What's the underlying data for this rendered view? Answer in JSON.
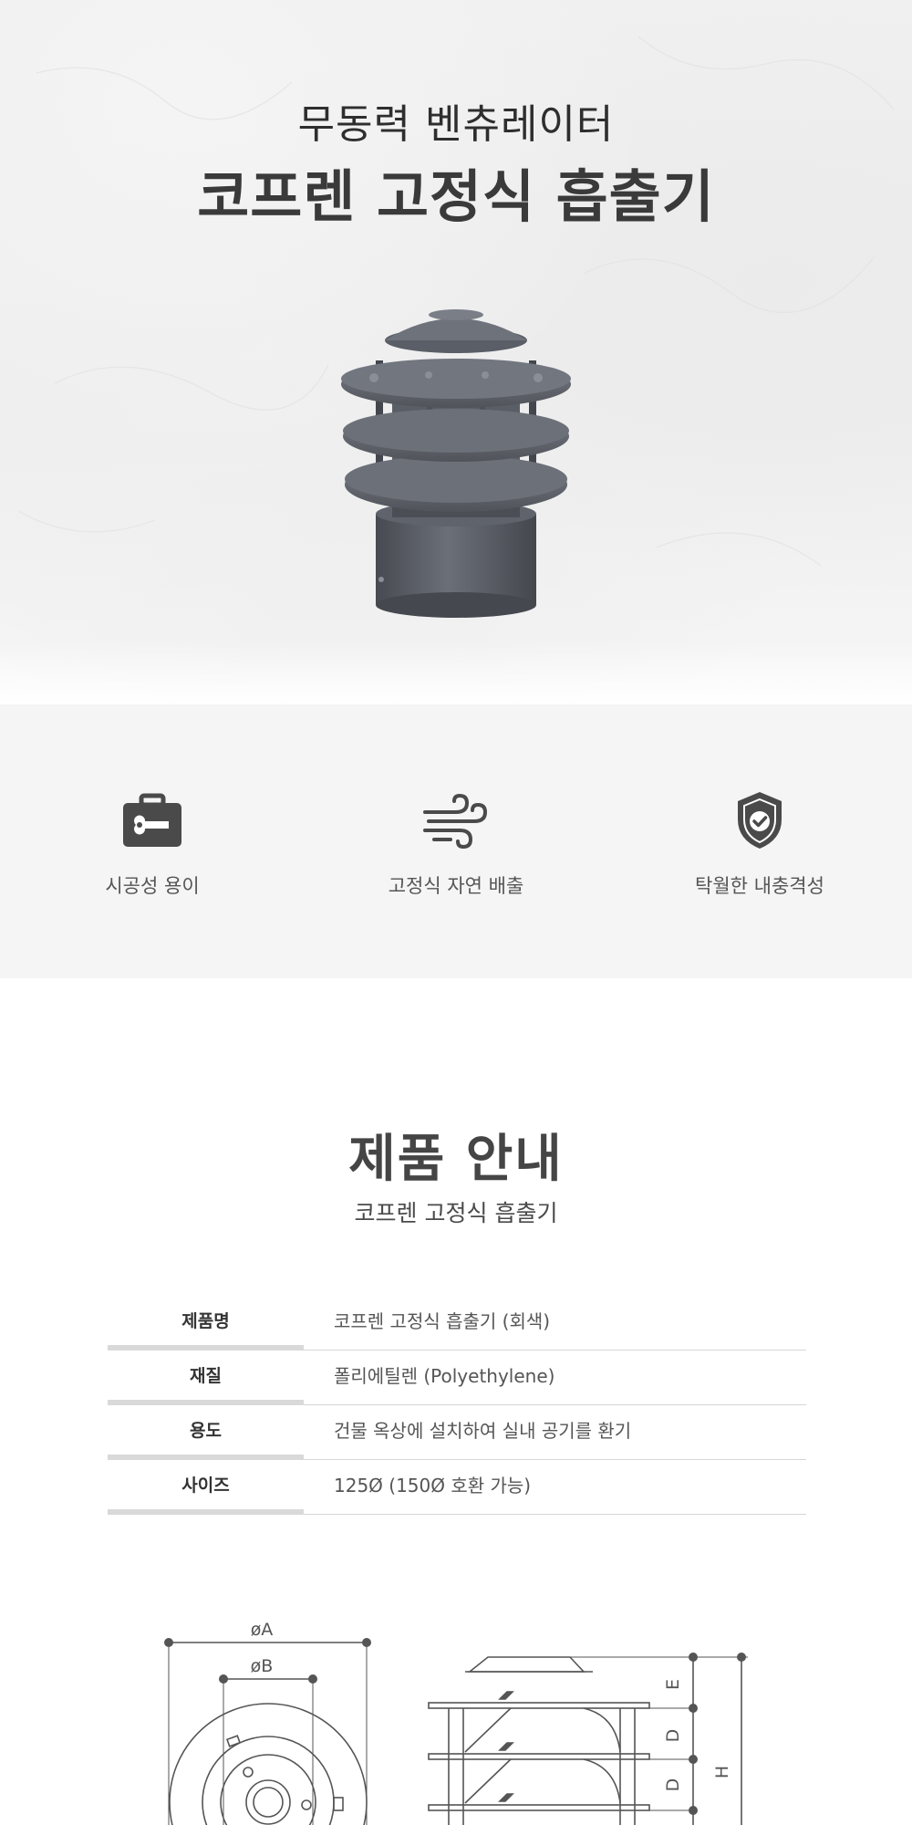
{
  "hero": {
    "subtitle": "무동력 벤츄레이터",
    "title": "코프렌 고정식 흡출기"
  },
  "features": [
    {
      "icon": "toolbox-wrench-icon",
      "label": "시공성 용이"
    },
    {
      "icon": "wind-icon",
      "label": "고정식 자연 배출"
    },
    {
      "icon": "shield-check-icon",
      "label": "탁월한 내충격성"
    }
  ],
  "info": {
    "title": "제품 안내",
    "subtitle": "코프렌 고정식 흡출기",
    "specs": [
      {
        "label": "제품명",
        "value": "코프렌 고정식 흡출기 (회색)"
      },
      {
        "label": "재질",
        "value": "폴리에틸렌 (Polyethylene)"
      },
      {
        "label": "용도",
        "value": "건물 옥상에 설치하여 실내 공기를 환기"
      },
      {
        "label": "사이즈",
        "value": "125Ø (150Ø 호환 가능)"
      }
    ]
  },
  "diagram": {
    "labels": {
      "a": "øA",
      "b": "øB",
      "e": "E",
      "d1": "D",
      "d2": "D",
      "h": "H"
    }
  },
  "colors": {
    "product": "#5a5e66",
    "feature_bg": "#f5f5f5",
    "icon": "#4a4a4a"
  }
}
